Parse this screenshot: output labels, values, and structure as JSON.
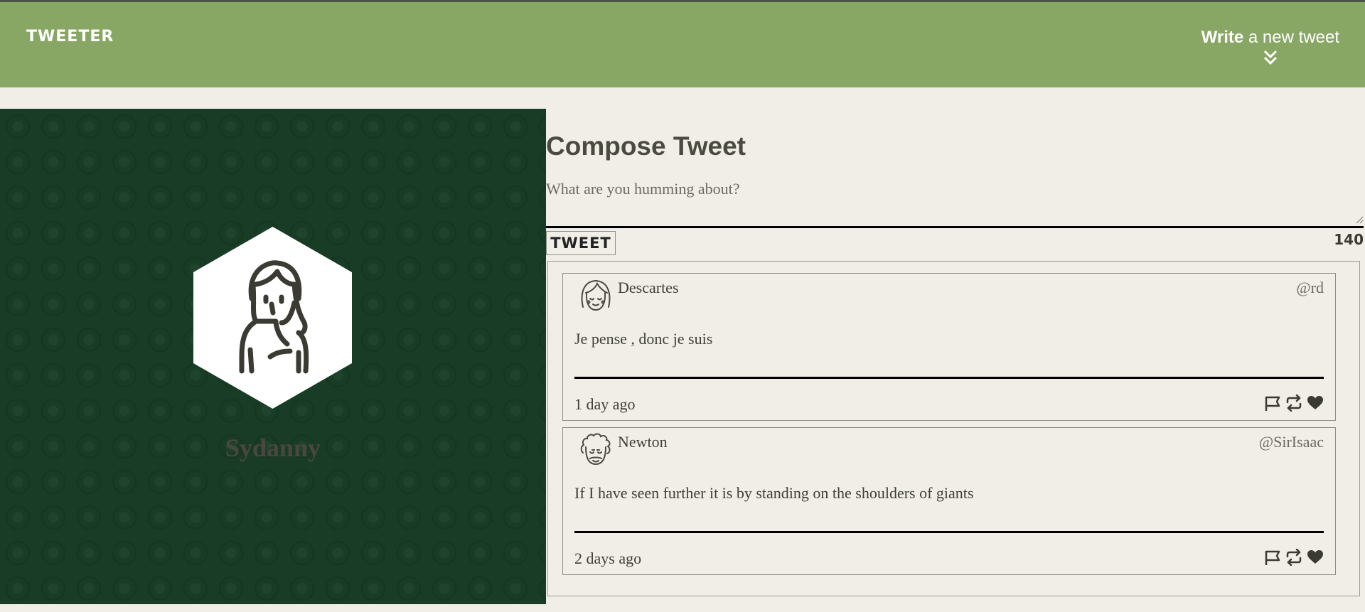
{
  "nav": {
    "brand": "TWEETER",
    "compose_bold": "Write",
    "compose_rest": " a new tweet",
    "compose_icon": "double-chevron-down-icon"
  },
  "profile": {
    "username": "Sydanny",
    "avatar_icon": "woman-avatar-icon"
  },
  "compose": {
    "heading": "Compose Tweet",
    "placeholder": "What are you humming about?",
    "submit_label": "TWEET",
    "counter": "140"
  },
  "tweets": [
    {
      "name": "Descartes",
      "handle": "@rd",
      "text": "Je pense , donc je suis",
      "time": "1 day ago",
      "avatar_icon": "bob-hair-avatar-icon"
    },
    {
      "name": "Newton",
      "handle": "@SirIsaac",
      "text": "If I have seen further it is by standing on the shoulders of giants",
      "time": "2 days ago",
      "avatar_icon": "curly-hair-avatar-icon"
    }
  ],
  "colors": {
    "navbar": "#88a764",
    "profile_bg": "#183c25",
    "page_bg": "#f1eee8"
  }
}
